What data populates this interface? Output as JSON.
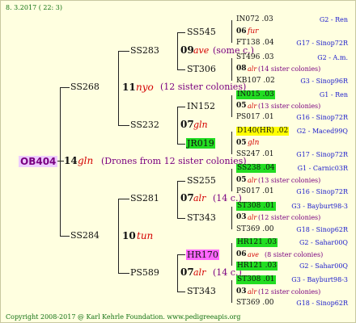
{
  "header": {
    "date": "8. 3.2017 ( 22: 3)"
  },
  "footer": {
    "copyright": "Copyright 2008-2017 @ Karl Kehrle Foundation.  www.pedigreeapis.org"
  },
  "root": {
    "id": "OB404",
    "gen": "14",
    "race": "gln",
    "note": "(Drones from 12 sister colonies)"
  },
  "sires": {
    "top": {
      "id": "SS268",
      "gen": "11",
      "race": "nyo",
      "note": "(12 sister colonies)"
    },
    "bottom": {
      "id": "SS284",
      "gen": "10",
      "race": "tun"
    }
  },
  "gen3": {
    "ss283": "SS283",
    "ss283_gen": "09",
    "ss283_race": "ave",
    "ss283_note": "(some c.)",
    "ss232": "SS232",
    "ss232_gen": "07",
    "ss232_race": "gln",
    "ss281": "SS281",
    "ss281_gen": "07",
    "ss281_race": "alr",
    "ss281_note": "(14 c.)",
    "ps589": "PS589",
    "ps589_gen": "07",
    "ps589_race": "alr",
    "ps589_note": "(14 c.)"
  },
  "gen4": {
    "ss545": "SS545",
    "ss545_gen": "06",
    "ss545_race": "fur",
    "st306": "ST306",
    "st306_gen": "08",
    "st306_race": "alr",
    "st306_note": "(14 sister colonies)",
    "in152": "IN152",
    "in152_gen": "05",
    "in152_race": "alr",
    "in152_note": "(13 sister colonies)",
    "jr019": "JR019",
    "jr019_gen": "05",
    "jr019_race": "gln",
    "ss255": "SS255",
    "ss255_gen": "05",
    "ss255_race": "alr",
    "ss255_note": "(13 sister colonies)",
    "st343a": "ST343",
    "st343a_gen": "03",
    "st343a_race": "alr",
    "st343a_note": "(12 sister colonies)",
    "hr170": "HR170",
    "hr170_gen": "06",
    "hr170_race": "ave",
    "hr170_note": "(8 sister colonies)",
    "st343b": "ST343",
    "st343b_gen": "03",
    "st343b_race": "alr",
    "st343b_note": "(12 sister colonies)"
  },
  "gen5": [
    {
      "id": "IN072 .03",
      "origin": "G2 - Ren"
    },
    {
      "id": "FT138 .04",
      "origin": "G17 - Sinop72R"
    },
    {
      "id": "ST496 .03",
      "origin": "G2 - A.m."
    },
    {
      "id": "KB107 .02",
      "origin": "G3 - Sinop96R"
    },
    {
      "id": "IN015 .03",
      "origin": "G1 - Ren"
    },
    {
      "id": "PS017 .01",
      "origin": "G16 - Sinop72R"
    },
    {
      "id": "D140(HR) .02",
      "origin": "G2 - Maced99Q"
    },
    {
      "id": "SS247 .01",
      "origin": "G17 - Sinop72R"
    },
    {
      "id": "SS238 .04",
      "origin": "G1 - Carnic03R"
    },
    {
      "id": "PS017 .01",
      "origin": "G16 - Sinop72R"
    },
    {
      "id": "ST308 .01",
      "origin": "G3 - Bayburt98-3"
    },
    {
      "id": "ST369 .00",
      "origin": "G18 - Sinop62R"
    },
    {
      "id": "HR121 .03",
      "origin": "G2 - Sahar00Q"
    },
    {
      "id": "HR121 .03",
      "origin": "G2 - Sahar00Q"
    },
    {
      "id": "ST308 .01",
      "origin": "G3 - Bayburt98-3"
    },
    {
      "id": "ST369 .00",
      "origin": "G18 - Sinop62R"
    }
  ]
}
